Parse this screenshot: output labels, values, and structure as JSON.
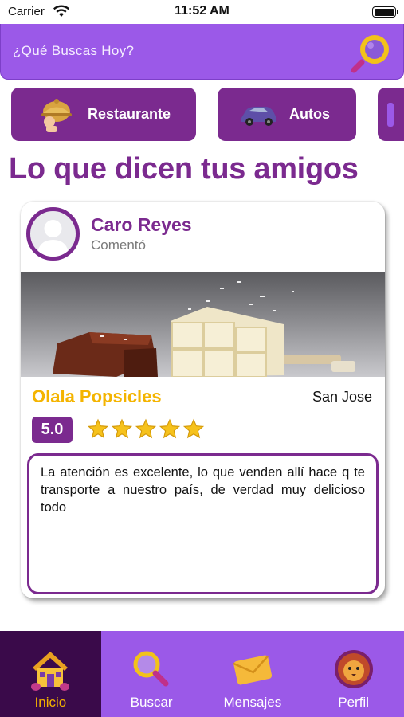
{
  "status_bar": {
    "carrier": "Carrier",
    "time": "11:52 AM"
  },
  "search": {
    "placeholder": "¿Qué Buscas Hoy?"
  },
  "categories": [
    {
      "label": "Restaurante",
      "icon": "cloche-chef-icon"
    },
    {
      "label": "Autos",
      "icon": "car-icon"
    }
  ],
  "section_title": "Lo que dicen tus amigos",
  "review": {
    "user_name": "Caro Reyes",
    "action": "Comentó",
    "place_name": "Olala Popsicles",
    "city": "San Jose",
    "rating": "5.0",
    "stars": 5,
    "comment": "La atención es excelente, lo que venden allí hace q te transporte a nuestro país, de verdad muy delicioso todo"
  },
  "tabs": [
    {
      "label": "Inicio",
      "icon": "house-icon",
      "active": true
    },
    {
      "label": "Buscar",
      "icon": "magnifier-icon",
      "active": false
    },
    {
      "label": "Mensajes",
      "icon": "envelope-icon",
      "active": false
    },
    {
      "label": "Perfil",
      "icon": "lion-icon",
      "active": false
    }
  ],
  "colors": {
    "primary": "#9b59e8",
    "brand": "#7b2a8f",
    "accent": "#f4b400",
    "active_tab": "#3a0a4a"
  }
}
